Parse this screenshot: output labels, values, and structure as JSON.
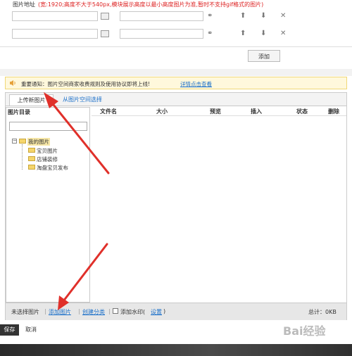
{
  "image_field": {
    "label": "图片地址",
    "hint": "(宽:1920;高度不大于540px,模块展示高度以最小高度图片为准,暂时不支持gif格式的图片)"
  },
  "rows": [
    {
      "image_value": "",
      "link_value": ""
    },
    {
      "image_value": "",
      "link_value": ""
    }
  ],
  "add_button": "添加",
  "notice": {
    "text": "重要通知：图片空间商家收费规则及使用协议即将上线!",
    "link": "详情点击查看"
  },
  "tabs": [
    {
      "label": "上传新图片",
      "active": true
    },
    {
      "label": "从图片空间选择",
      "active": false
    }
  ],
  "directory": {
    "title": "图片目录",
    "root": "我的图片",
    "children": [
      "宝贝图片",
      "店铺装修",
      "淘盘宝贝发布"
    ]
  },
  "table": {
    "columns": [
      "文件名",
      "大小",
      "预览",
      "插入",
      "状态",
      "删除"
    ]
  },
  "footer": {
    "status": "未选择图片",
    "add_image": "添加图片",
    "create_category": "创建分类",
    "watermark_label": "添加水印(",
    "settings": "设置",
    "close_paren": ")",
    "total": "总计：0KB"
  },
  "actions": {
    "save": "保存",
    "cancel": "取消"
  },
  "watermark_text": "Bai经验",
  "colors": {
    "hint_red": "#d22222",
    "link_blue": "#1a6fc9",
    "arrow_red": "#e0302a",
    "notice_bg": "#fff8dc"
  }
}
